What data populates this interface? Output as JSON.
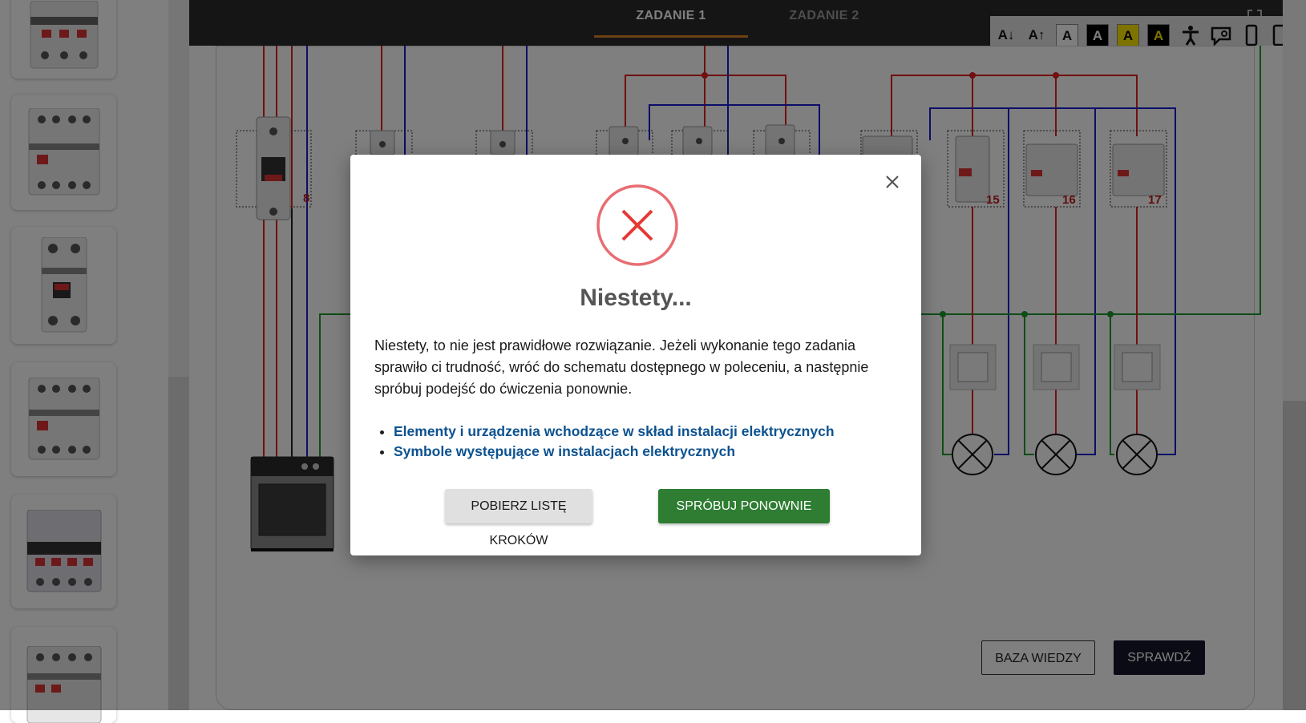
{
  "tabs": [
    {
      "label": "ZADANIE 1",
      "active": true
    },
    {
      "label": "ZADANIE 2",
      "active": false
    }
  ],
  "accessibility": {
    "text_smaller": "A↓",
    "text_larger": "A↑",
    "contrast_default": "A",
    "contrast_black_white": "A",
    "contrast_yellow_black": "A",
    "contrast_black_yellow": "A",
    "icons": [
      "text-smaller-icon",
      "text-larger-icon",
      "contrast-default-icon",
      "contrast-black-white-icon",
      "contrast-yellow-black-icon",
      "contrast-black-yellow-icon",
      "accessibility-person-icon",
      "sign-language-icon",
      "phone-view-icon",
      "tablet-view-icon"
    ]
  },
  "diagram": {
    "labels": [
      "8",
      "15",
      "16",
      "17"
    ]
  },
  "buttons": {
    "knowledge_base": "BAZA WIEDZY",
    "check": "SPRAWDŹ"
  },
  "modal": {
    "title": "Niestety...",
    "message": "Niestety, to nie jest prawidłowe rozwiązanie. Jeżeli wykonanie tego zadania sprawiło ci trudność, wróć do schematu dostępnego w poleceniu, a następnie spróbuj podejść do ćwiczenia ponownie.",
    "links": [
      "Elementy i urządzenia wchodzące w skład instalacji elektrycznych",
      "Symbole występujące w instalacjach elektrycznych"
    ],
    "download_button": "POBIERZ LISTĘ KROKÓW",
    "retry_button": "SPRÓBUJ PONOWNIE"
  },
  "colors": {
    "phase_wire": "#e02020",
    "neutral_wire": "#1a1ad0",
    "earth_wire": "#1f9a2e",
    "accent_tab": "#d9822b",
    "retry_green": "#2e7d32",
    "link_blue": "#0c5290",
    "error_red": "#e53935"
  }
}
